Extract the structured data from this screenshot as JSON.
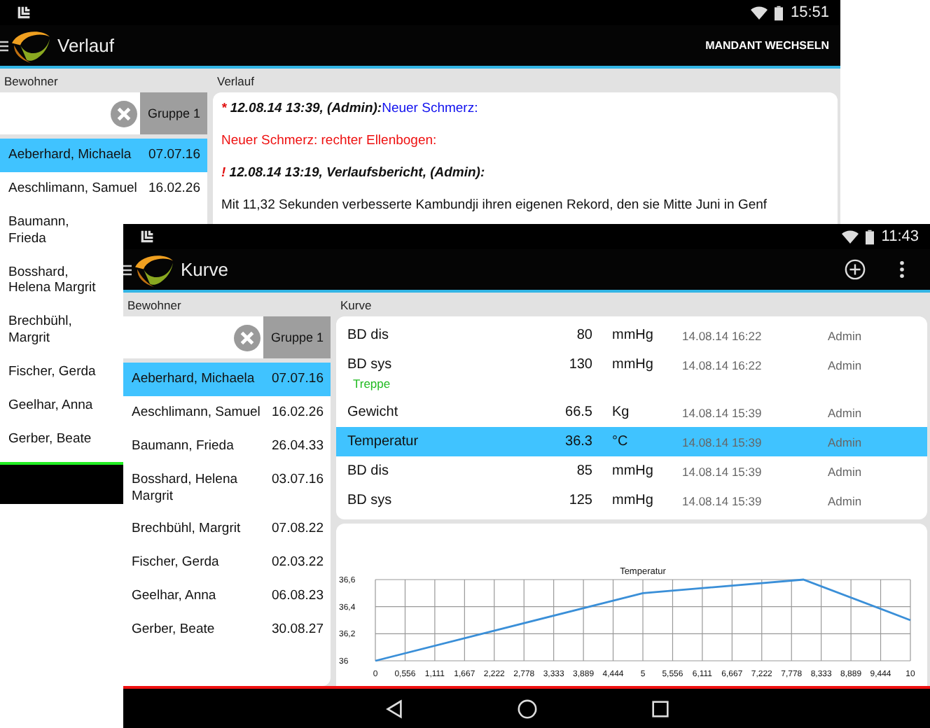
{
  "back_screen": {
    "status_bar": {
      "time": "15:51"
    },
    "action_bar": {
      "title": "Verlauf",
      "action": "MANDANT WECHSELN"
    },
    "residents_header": "Bewohner",
    "group_button": "Gruppe 1",
    "residents": [
      {
        "name": "Aeberhard, Michaela",
        "date": "07.07.16",
        "selected": true
      },
      {
        "name": "Aeschlimann, Samuel",
        "date": "16.02.26",
        "selected": false
      },
      {
        "name": "Baumann, Frieda",
        "selected": false
      },
      {
        "name": "Bosshard, Helena Margrit",
        "selected": false
      },
      {
        "name": "Brechbühl, Margrit",
        "selected": false
      },
      {
        "name": "Fischer, Gerda",
        "selected": false
      },
      {
        "name": "Geelhar, Anna",
        "selected": false
      },
      {
        "name": "Gerber, Beate",
        "selected": false
      }
    ],
    "content_header": "Verlauf",
    "entries": [
      {
        "kind": "heading",
        "marker": "*",
        "text": "12.08.14 13:39, (Admin):",
        "subject": "Neuer Schmerz:"
      },
      {
        "kind": "alert",
        "text": "Neuer Schmerz: rechter Ellenbogen:"
      },
      {
        "kind": "heading",
        "marker": "!",
        "text": "12.08.14 13:19, Verlaufsbericht, (Admin):"
      },
      {
        "kind": "paragraph",
        "text": "Mit 11,32 Sekunden verbesserte Kambundji ihren eigenen Rekord, den sie Mitte Juni in Genf"
      }
    ]
  },
  "front_screen": {
    "status_bar": {
      "time": "11:43"
    },
    "action_bar": {
      "title": "Kurve"
    },
    "residents_header": "Bewohner",
    "group_button": "Gruppe 1",
    "residents": [
      {
        "name": "Aeberhard, Michaela",
        "date": "07.07.16",
        "selected": true
      },
      {
        "name": "Aeschlimann, Samuel",
        "date": "16.02.26",
        "selected": false
      },
      {
        "name": "Baumann, Frieda",
        "date": "26.04.33",
        "selected": false
      },
      {
        "name": "Bosshard, Helena Margrit",
        "date": "03.07.16",
        "selected": false
      },
      {
        "name": "Brechbühl, Margrit",
        "date": "07.08.22",
        "selected": false
      },
      {
        "name": "Fischer, Gerda",
        "date": "02.03.22",
        "selected": false
      },
      {
        "name": "Geelhar, Anna",
        "date": "06.08.23",
        "selected": false
      },
      {
        "name": "Gerber, Beate",
        "date": "30.08.27",
        "selected": false
      }
    ],
    "content_header": "Kurve",
    "measurements": [
      {
        "name": "BD dis",
        "value": "80",
        "unit": "mmHg",
        "time": "14.08.14 16:22",
        "user": "Admin",
        "selected": false
      },
      {
        "name": "BD sys",
        "value": "130",
        "unit": "mmHg",
        "time": "14.08.14 16:22",
        "user": "Admin",
        "note": "Treppe",
        "selected": false
      },
      {
        "name": "Gewicht",
        "value": "66.5",
        "unit": "Kg",
        "time": "14.08.14 15:39",
        "user": "Admin",
        "selected": false
      },
      {
        "name": "Temperatur",
        "value": "36.3",
        "unit": "°C",
        "time": "14.08.14 15:39",
        "user": "Admin",
        "selected": true
      },
      {
        "name": "BD dis",
        "value": "85",
        "unit": "mmHg",
        "time": "14.08.14 15:39",
        "user": "Admin",
        "selected": false
      },
      {
        "name": "BD sys",
        "value": "125",
        "unit": "mmHg",
        "time": "14.08.14 15:39",
        "user": "Admin",
        "selected": false
      }
    ],
    "chart_data": {
      "type": "line",
      "title": "Temperatur",
      "x": [
        0,
        5,
        8,
        10
      ],
      "series": [
        {
          "color": "#3a8fd8",
          "values": [
            36,
            36.5,
            36.6,
            36.3
          ]
        }
      ],
      "grid": true,
      "xlim": [
        0,
        10
      ],
      "ylim": [
        36,
        36.6
      ],
      "xticks": [
        {
          "value": 0,
          "label": "0"
        },
        {
          "value": 0.556,
          "label": "0,556"
        },
        {
          "value": 1.111,
          "label": "1,111"
        },
        {
          "value": 1.667,
          "label": "1,667"
        },
        {
          "value": 2.222,
          "label": "2,222"
        },
        {
          "value": 2.778,
          "label": "2,778"
        },
        {
          "value": 3.333,
          "label": "3,333"
        },
        {
          "value": 3.889,
          "label": "3,889"
        },
        {
          "value": 4.444,
          "label": "4,444"
        },
        {
          "value": 5,
          "label": "5"
        },
        {
          "value": 5.556,
          "label": "5,556"
        },
        {
          "value": 6.111,
          "label": "6,111"
        },
        {
          "value": 6.667,
          "label": "6,667"
        },
        {
          "value": 7.222,
          "label": "7,222"
        },
        {
          "value": 7.778,
          "label": "7,778"
        },
        {
          "value": 8.333,
          "label": "8,333"
        },
        {
          "value": 8.889,
          "label": "8,889"
        },
        {
          "value": 9.444,
          "label": "9,444"
        },
        {
          "value": 10,
          "label": "10"
        }
      ],
      "yticks": [
        {
          "value": 36,
          "label": "36"
        },
        {
          "value": 36.2,
          "label": "36,2"
        },
        {
          "value": 36.4,
          "label": "36,4"
        },
        {
          "value": 36.6,
          "label": "36,6"
        }
      ]
    }
  }
}
